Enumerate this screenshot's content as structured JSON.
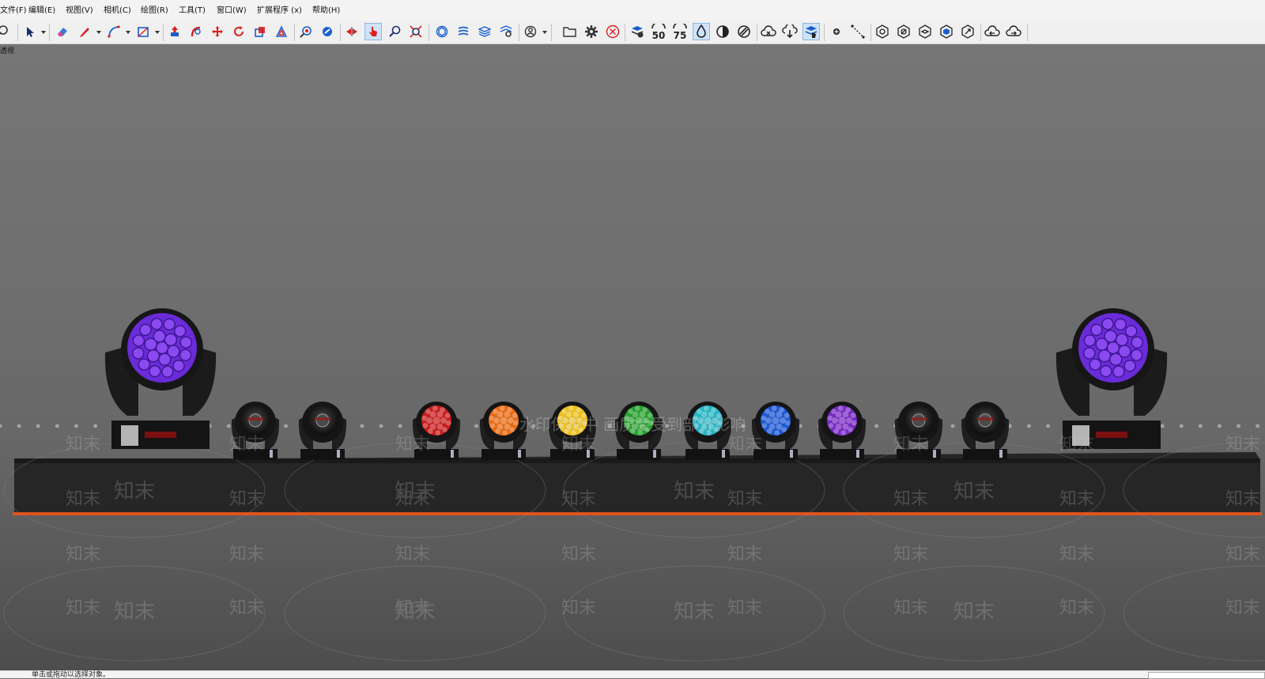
{
  "menu": [
    "文件(F)",
    "编辑(E)",
    "视图(V)",
    "相机(C)",
    "绘图(R)",
    "工具(T)",
    "窗口(W)",
    "扩展程序 (x)",
    "帮助(H)"
  ],
  "toolbar": {
    "labels": {
      "precision_50": "50",
      "precision_75": "75"
    },
    "icons": [
      "zoom-icon",
      "select-icon",
      "eraser-icon",
      "pencil-icon",
      "arc-icon",
      "rectangle-icon",
      "push-pull-icon",
      "follow-me-icon",
      "move-icon",
      "rotate-icon",
      "scale-icon",
      "offset-icon",
      "section-icon",
      "explode-icon",
      "mirror-icon",
      "select-tool-icon",
      "search-icon",
      "fit-icon",
      "component-icon",
      "layers-icon",
      "stack-icon",
      "settings-layers-icon",
      "user-icon",
      "folder-icon",
      "gear-icon",
      "close-circle-icon",
      "reduce-icon",
      "precision-50-icon",
      "precision-75-icon",
      "drop-icon",
      "contrast-icon",
      "hatch-icon",
      "cloud-cross-icon",
      "cloud-down-icon",
      "cloud-hand-icon",
      "dot-icon",
      "line-icon",
      "box-icon",
      "box-slash-icon",
      "box-open-icon",
      "box-solid-icon",
      "box-arrow-icon",
      "cloud-left-icon",
      "cloud-right-icon"
    ]
  },
  "viewport": {
    "label": "透视",
    "watermark_banner": "水印保护中 画质会受到部分影响",
    "watermark_logo": "知末"
  },
  "scene": {
    "big_light_color": "#6a2bd8",
    "beam_colors": [
      "#cc1a1a",
      "#ee6a10",
      "#f2c418",
      "#22a22a",
      "#22b8c8",
      "#1a58d8",
      "#7a28c8"
    ],
    "stage_trim_color": "#e0531d"
  },
  "statusbar": {
    "text": "单击或拖动以选择对象。"
  }
}
